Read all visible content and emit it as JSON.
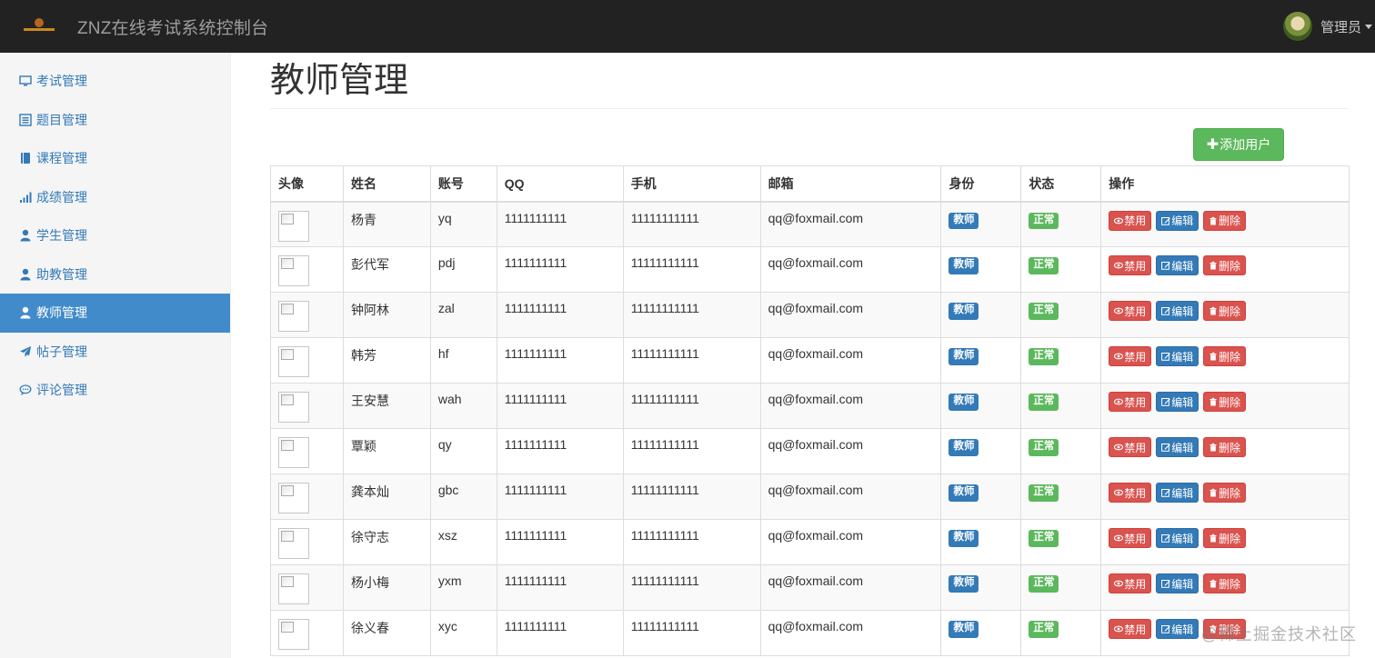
{
  "navbar": {
    "brand": "ZNZ在线考试系统控制台",
    "user_label": "管理员"
  },
  "sidebar": {
    "items": [
      {
        "label": "考试管理",
        "icon": "monitor-icon"
      },
      {
        "label": "题目管理",
        "icon": "list-icon"
      },
      {
        "label": "课程管理",
        "icon": "book-icon"
      },
      {
        "label": "成绩管理",
        "icon": "signal-icon"
      },
      {
        "label": "学生管理",
        "icon": "user-icon"
      },
      {
        "label": "助教管理",
        "icon": "user-icon"
      },
      {
        "label": "教师管理",
        "icon": "user-icon",
        "active": true
      },
      {
        "label": "帖子管理",
        "icon": "send-icon"
      },
      {
        "label": "评论管理",
        "icon": "comment-icon"
      }
    ]
  },
  "main": {
    "title": "教师管理",
    "add_button": "添加用户"
  },
  "table": {
    "headers": [
      "头像",
      "姓名",
      "账号",
      "QQ",
      "手机",
      "邮箱",
      "身份",
      "状态",
      "操作"
    ],
    "rows": [
      {
        "name": "杨青",
        "account": "yq",
        "qq": "1111111111",
        "phone": "11111111111",
        "email": "qq@foxmail.com",
        "role": "教师",
        "status": "正常"
      },
      {
        "name": "彭代军",
        "account": "pdj",
        "qq": "1111111111",
        "phone": "11111111111",
        "email": "qq@foxmail.com",
        "role": "教师",
        "status": "正常"
      },
      {
        "name": "钟阿林",
        "account": "zal",
        "qq": "1111111111",
        "phone": "11111111111",
        "email": "qq@foxmail.com",
        "role": "教师",
        "status": "正常"
      },
      {
        "name": "韩芳",
        "account": "hf",
        "qq": "1111111111",
        "phone": "11111111111",
        "email": "qq@foxmail.com",
        "role": "教师",
        "status": "正常"
      },
      {
        "name": "王安慧",
        "account": "wah",
        "qq": "1111111111",
        "phone": "11111111111",
        "email": "qq@foxmail.com",
        "role": "教师",
        "status": "正常"
      },
      {
        "name": "覃颖",
        "account": "qy",
        "qq": "1111111111",
        "phone": "11111111111",
        "email": "qq@foxmail.com",
        "role": "教师",
        "status": "正常"
      },
      {
        "name": "龚本灿",
        "account": "gbc",
        "qq": "1111111111",
        "phone": "11111111111",
        "email": "qq@foxmail.com",
        "role": "教师",
        "status": "正常"
      },
      {
        "name": "徐守志",
        "account": "xsz",
        "qq": "1111111111",
        "phone": "11111111111",
        "email": "qq@foxmail.com",
        "role": "教师",
        "status": "正常"
      },
      {
        "name": "杨小梅",
        "account": "yxm",
        "qq": "1111111111",
        "phone": "11111111111",
        "email": "qq@foxmail.com",
        "role": "教师",
        "status": "正常"
      },
      {
        "name": "徐义春",
        "account": "xyc",
        "qq": "1111111111",
        "phone": "11111111111",
        "email": "qq@foxmail.com",
        "role": "教师",
        "status": "正常"
      }
    ],
    "actions": {
      "disable": "禁用",
      "edit": "编辑",
      "delete": "删除"
    }
  },
  "watermark": "@稀土掘金技术社区",
  "colors": {
    "navbar": "#222222",
    "active": "#428bca",
    "link": "#337ab7",
    "success": "#5cb85c",
    "danger": "#d9534f"
  }
}
